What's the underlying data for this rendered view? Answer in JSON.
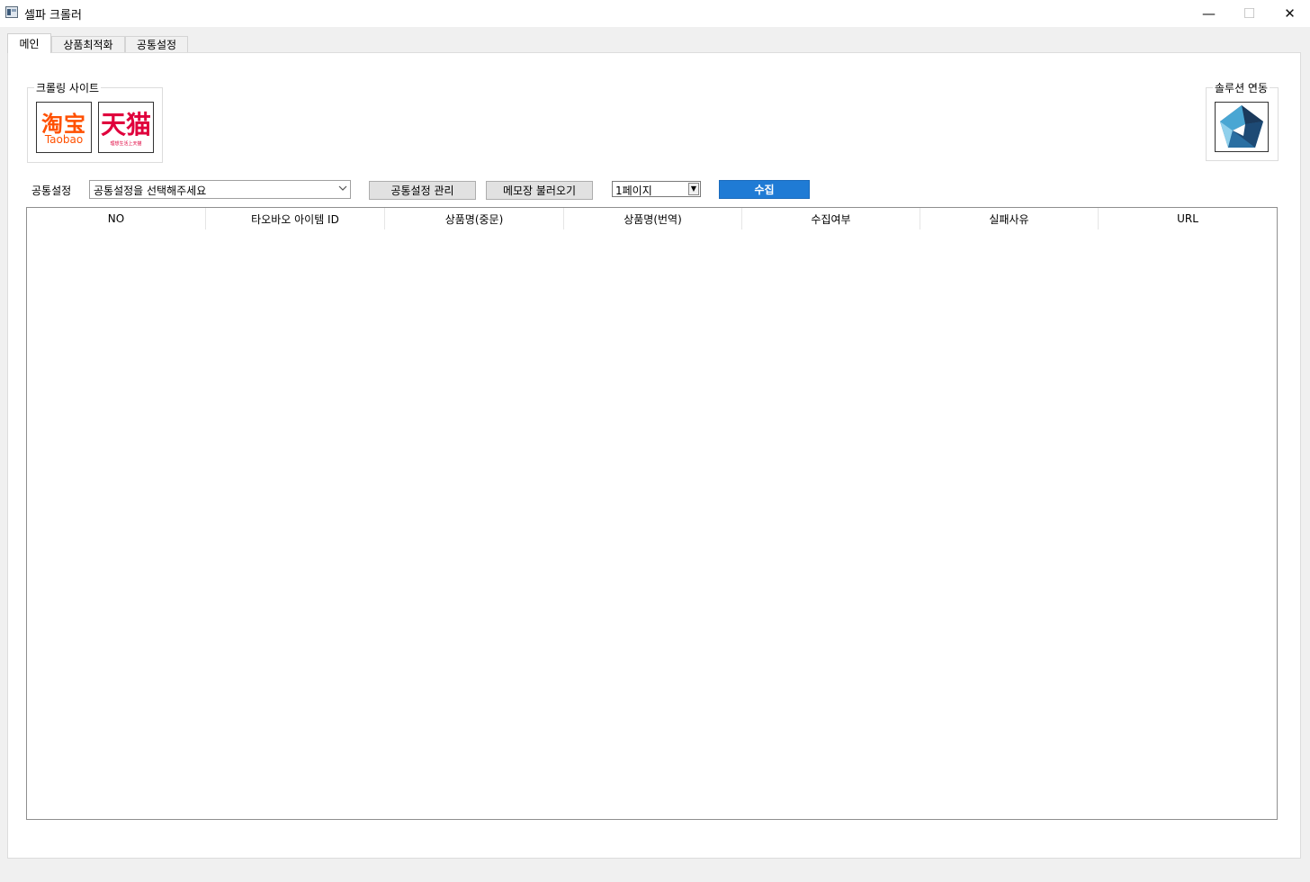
{
  "window": {
    "title": "셀파 크롤러",
    "controls": {
      "minimize": "—",
      "maximize": "☐",
      "close": "✕"
    },
    "icon": "app-window-icon"
  },
  "tabs": [
    {
      "label": "메인",
      "active": true
    },
    {
      "label": "상품최적화",
      "active": false
    },
    {
      "label": "공통설정",
      "active": false
    }
  ],
  "crawling_sites": {
    "title": "크롤링 사이트",
    "taobao": {
      "zh": "淘宝",
      "en": "Taobao",
      "color": "#ff5000"
    },
    "tmall": {
      "zh": "天猫",
      "slogan": "理想生活上天猫",
      "color": "#e0003c"
    }
  },
  "solution": {
    "title": "솔루션 연동",
    "logo": "pentagon-logo-icon",
    "colors": [
      "#1b3a5c",
      "#2c6a99",
      "#49a6d3",
      "#8fd0ec"
    ]
  },
  "toolbar": {
    "common_label": "공통설정",
    "combo_placeholder": "공통설정을 선택해주세요",
    "manage_button": "공통설정 관리",
    "memo_button": "메모장 불러오기",
    "page_select": "1페이지",
    "collect_button": "수집",
    "collect_color": "#1f7bd5"
  },
  "table": {
    "columns": [
      "NO",
      "타오바오 아이템 ID",
      "상품명(중문)",
      "상품명(번역)",
      "수집여부",
      "실패사유",
      "URL"
    ],
    "rows": []
  }
}
